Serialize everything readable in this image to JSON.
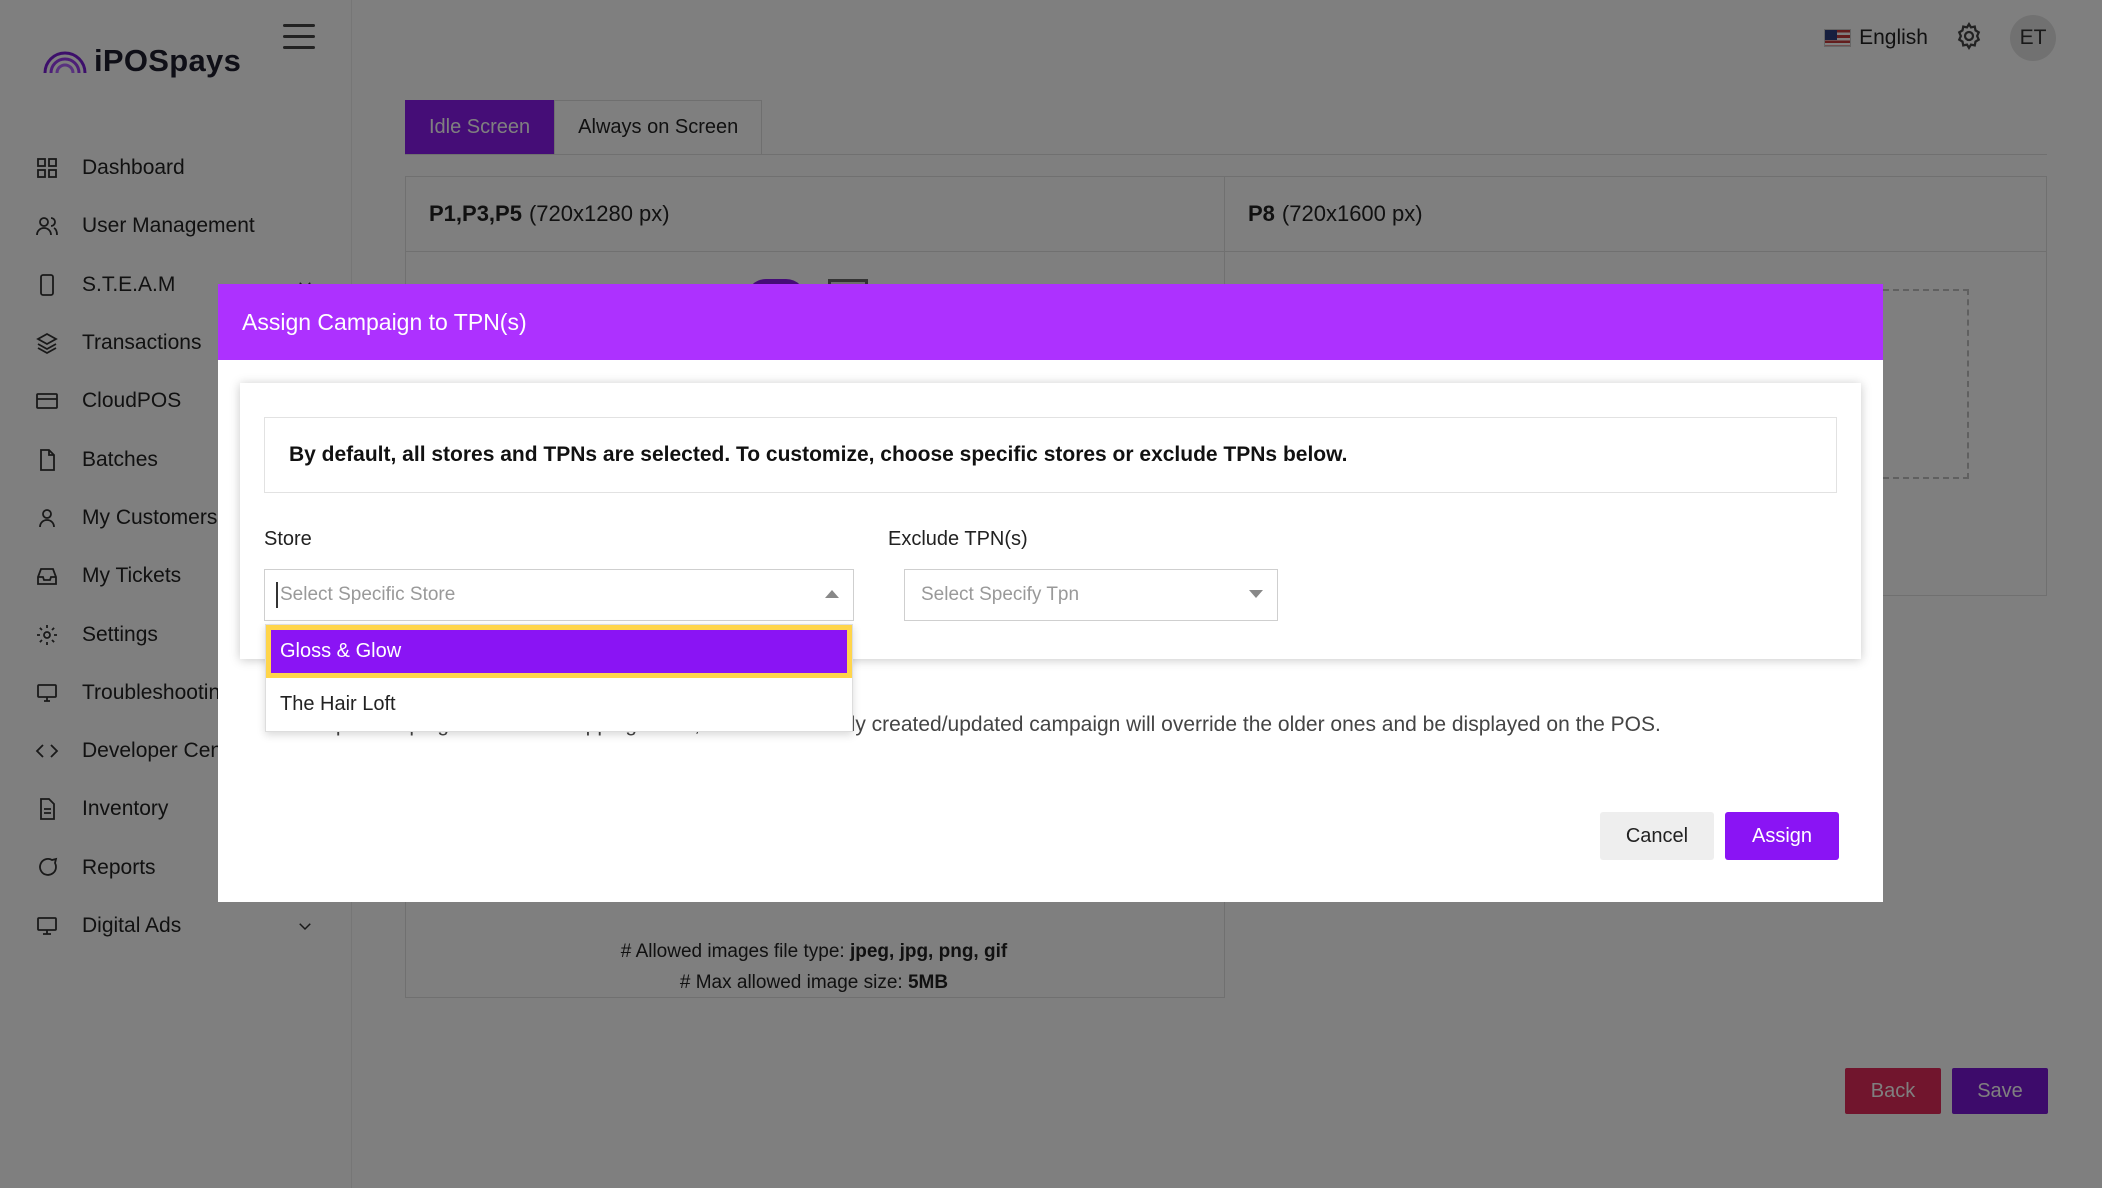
{
  "brand": {
    "name": "iPOSpays"
  },
  "colors": {
    "accent": "#8a14f4",
    "modal_header": "#ad31ff",
    "danger": "#e22a5a"
  },
  "sidebar": {
    "items": [
      {
        "label": "Dashboard",
        "icon": "grid-icon"
      },
      {
        "label": "User Management",
        "icon": "users-icon"
      },
      {
        "label": "S.T.E.A.M",
        "icon": "device-icon"
      },
      {
        "label": "Transactions",
        "icon": "layers-icon"
      },
      {
        "label": "CloudPOS",
        "icon": "card-icon"
      },
      {
        "label": "Batches",
        "icon": "file-icon"
      },
      {
        "label": "My Customers",
        "icon": "user-icon"
      },
      {
        "label": "My Tickets",
        "icon": "inbox-icon"
      },
      {
        "label": "Settings",
        "icon": "gear-icon"
      },
      {
        "label": "Troubleshooting",
        "icon": "monitor-icon"
      },
      {
        "label": "Developer Center",
        "icon": "code-icon"
      },
      {
        "label": "Inventory",
        "icon": "document-icon"
      },
      {
        "label": "Reports",
        "icon": "chat-icon"
      },
      {
        "label": "Digital Ads",
        "icon": "screen-icon"
      }
    ]
  },
  "topbar": {
    "language": "English",
    "avatar_initials": "ET"
  },
  "tabs": {
    "idle": "Idle Screen",
    "always": "Always on Screen"
  },
  "panels": {
    "left": {
      "title_bold": "P1,P3,P5",
      "title_rest": "(720x1280 px)"
    },
    "right": {
      "title_bold": "P8",
      "title_rest": "(720x1600 px)"
    }
  },
  "file_info": {
    "types_label": "# Allowed images file type:",
    "types_value": "jpeg, jpg, png, gif",
    "size_label": "# Max allowed image size:",
    "size_value": "5MB"
  },
  "page_buttons": {
    "back": "Back",
    "save": "Save"
  },
  "modal": {
    "title": "Assign Campaign to TPN(s)",
    "info": "By default, all stores and TPNs are selected. To customize, choose specific stores or exclude TPNs below.",
    "store_label": "Store",
    "store_placeholder": "Select Specific Store",
    "exclude_label": "Exclude TPN(s)",
    "exclude_placeholder": "Select Specify Tpn",
    "note": "# Multiple campaigns have overlapping dates, the most recently created/updated campaign will override the older ones and be displayed on the POS.",
    "cancel": "Cancel",
    "assign": "Assign",
    "store_options": [
      "Gloss & Glow",
      "The Hair Loft"
    ]
  }
}
